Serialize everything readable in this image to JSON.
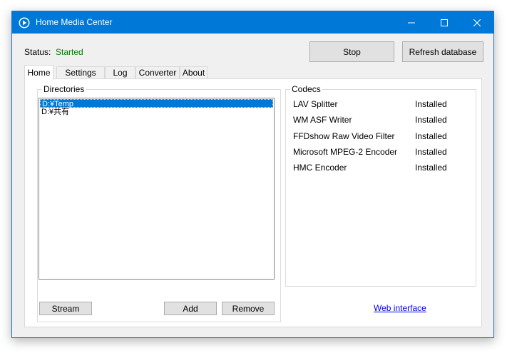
{
  "window": {
    "title": "Home Media Center"
  },
  "titlebar": {
    "minimize_glyph": "—",
    "maximize_glyph": "☐",
    "close_glyph": "✕"
  },
  "status": {
    "label": "Status:",
    "value": "Started",
    "value_color": "#008000"
  },
  "toolbar": {
    "stop_label": "Stop",
    "refresh_label": "Refresh database"
  },
  "tabs": [
    {
      "label": "Home",
      "active": true
    },
    {
      "label": "Settings",
      "active": false
    },
    {
      "label": "Log",
      "active": false
    },
    {
      "label": "Converter",
      "active": false
    },
    {
      "label": "About",
      "active": false
    }
  ],
  "directories": {
    "title": "Directories",
    "items": [
      {
        "path": "D:¥Temp",
        "selected": true
      },
      {
        "path": "D:¥共有",
        "selected": false
      }
    ],
    "stream_label": "Stream",
    "add_label": "Add",
    "remove_label": "Remove"
  },
  "codecs": {
    "title": "Codecs",
    "rows": [
      {
        "name": "LAV Splitter",
        "status": "Installed"
      },
      {
        "name": "WM ASF Writer",
        "status": "Installed"
      },
      {
        "name": "FFDshow Raw Video Filter",
        "status": "Installed"
      },
      {
        "name": "Microsoft MPEG-2 Encoder",
        "status": "Installed"
      },
      {
        "name": "HMC Encoder",
        "status": "Installed"
      }
    ]
  },
  "web_interface_label": "Web interface",
  "colors": {
    "titlebar": "#0078d7",
    "accent_selection": "#0078d7",
    "link": "#0000ee"
  }
}
